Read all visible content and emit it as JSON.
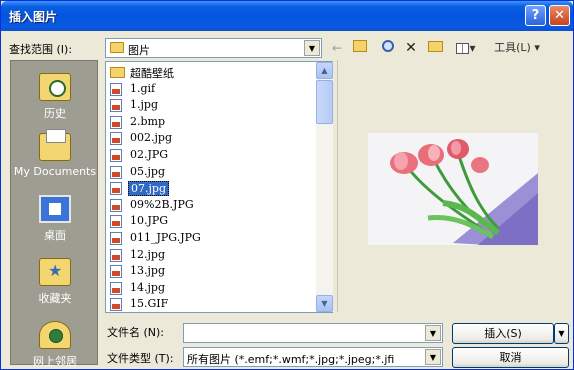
{
  "window": {
    "title": "插入图片",
    "help_glyph": "?",
    "close_glyph": "✕"
  },
  "toolbar": {
    "lookin_label": "查找范围 (I):",
    "lookin_value": "图片",
    "back_glyph": "←",
    "delete_glyph": "✕",
    "views_glyph": "▾",
    "tools_label": "工具(L) ▾",
    "icons": [
      "back-icon",
      "up-one-level-icon",
      "search-web-icon",
      "delete-icon",
      "new-folder-icon",
      "views-icon"
    ]
  },
  "places": [
    {
      "label": "历史",
      "icon": "history-icon"
    },
    {
      "label": "My Documents",
      "icon": "my-documents-icon"
    },
    {
      "label": "桌面",
      "icon": "desktop-icon"
    },
    {
      "label": "收藏夹",
      "icon": "favorites-icon"
    },
    {
      "label": "网上邻居",
      "icon": "network-places-icon"
    }
  ],
  "files": [
    {
      "name": "超酷壁纸",
      "type": "folder"
    },
    {
      "name": "1.gif",
      "type": "image"
    },
    {
      "name": "1.jpg",
      "type": "image"
    },
    {
      "name": "2.bmp",
      "type": "image"
    },
    {
      "name": "002.jpg",
      "type": "image"
    },
    {
      "name": "02.JPG",
      "type": "image"
    },
    {
      "name": "05.jpg",
      "type": "image"
    },
    {
      "name": "07.jpg",
      "type": "image",
      "selected": true
    },
    {
      "name": "09%2B.JPG",
      "type": "image"
    },
    {
      "name": "10.JPG",
      "type": "image"
    },
    {
      "name": "011_JPG.JPG",
      "type": "image"
    },
    {
      "name": "12.jpg",
      "type": "image"
    },
    {
      "name": "13.jpg",
      "type": "image"
    },
    {
      "name": "14.jpg",
      "type": "image"
    },
    {
      "name": "15.GIF",
      "type": "image"
    }
  ],
  "scrollbar": {
    "up_glyph": "▲",
    "down_glyph": "▼"
  },
  "footer": {
    "filename_label": "文件名 (N):",
    "filename_value": "",
    "filetype_label": "文件类型 (T):",
    "filetype_value": "所有图片 (*.emf;*.wmf;*.jpg;*.jpeg;*.jfi",
    "insert_button": "插入(S)",
    "cancel_button": "取消",
    "dropdown_glyph": "▼"
  },
  "colors": {
    "titlebar": "#0454df",
    "selection": "#316ac5",
    "dialog_bg": "#ece9d8",
    "places_bg": "#9d9d92"
  }
}
